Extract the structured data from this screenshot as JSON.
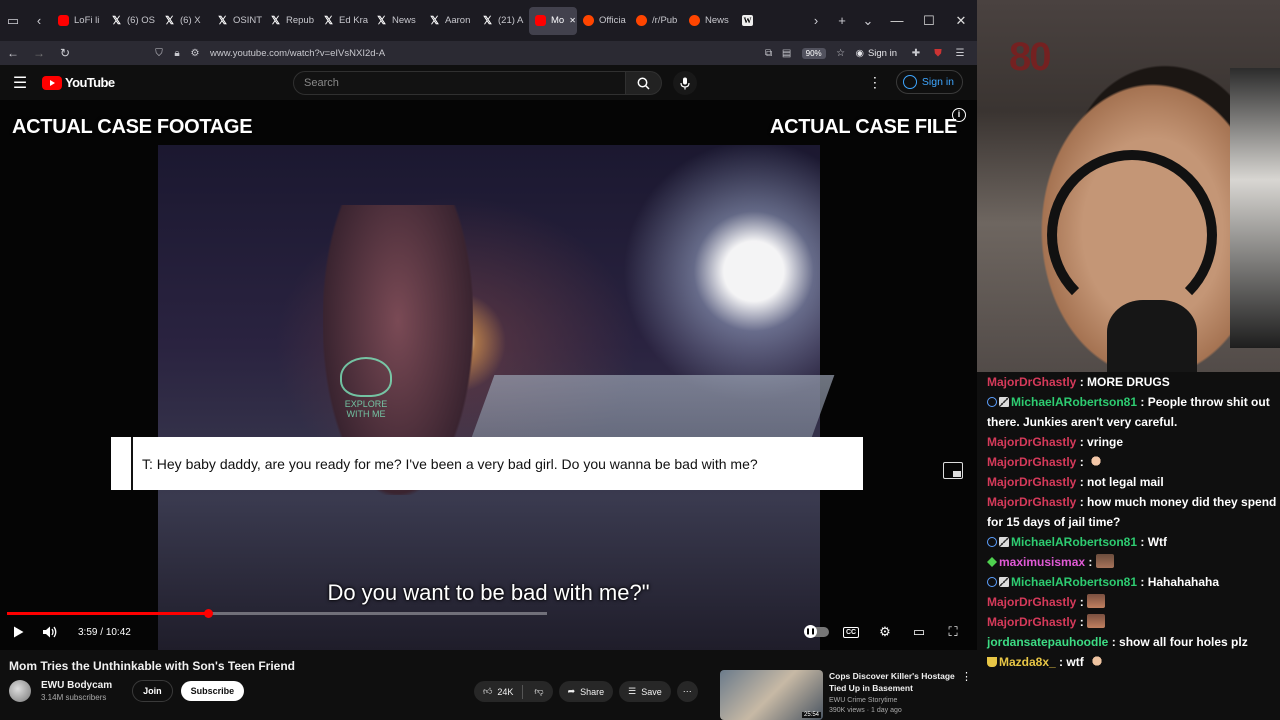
{
  "browser": {
    "tabs": [
      {
        "label": "LoFi li",
        "icon": "youtube",
        "active": false
      },
      {
        "label": "(6) OS",
        "icon": "x",
        "active": false
      },
      {
        "label": "(6) X",
        "icon": "x",
        "active": false
      },
      {
        "label": "OSINT",
        "icon": "x",
        "active": false
      },
      {
        "label": "Repub",
        "icon": "x",
        "active": false
      },
      {
        "label": "Ed Kra",
        "icon": "x",
        "active": false
      },
      {
        "label": "News",
        "icon": "x",
        "active": false
      },
      {
        "label": "Aaron",
        "icon": "x",
        "active": false
      },
      {
        "label": "(21) A",
        "icon": "x",
        "active": false
      },
      {
        "label": "Mo",
        "icon": "youtube",
        "active": true
      },
      {
        "label": "Officia",
        "icon": "reddit",
        "active": false
      },
      {
        "label": "/r/Pub",
        "icon": "reddit",
        "active": false
      },
      {
        "label": "News",
        "icon": "reddit",
        "active": false
      },
      {
        "label": "W",
        "icon": "wiki",
        "active": false
      }
    ],
    "url": "www.youtube.com/watch?v=eIVsNXI2d-A",
    "zoom": "90%",
    "sign_in": "Sign in",
    "ext_badge": "229"
  },
  "youtube": {
    "logo_text": "YouTube",
    "search_placeholder": "Search",
    "sign_in": "Sign in",
    "video": {
      "label_left": "ACTUAL CASE FOOTAGE",
      "label_right": "ACTUAL CASE FILE",
      "text_message": "T: Hey baby daddy, are you ready for me? I've been a very bad girl. Do you wanna be bad with me?",
      "subtitle": "Do you want to be bad with me?\"",
      "watermark": "EXPLORE WITH ME",
      "time_current": "3:59",
      "time_total": "10:42",
      "progress": 0.372
    },
    "title": "Mom Tries the Unthinkable with Son's Teen Friend",
    "channel": {
      "name": "EWU Bodycam",
      "subscribers": "3.14M subscribers",
      "join": "Join",
      "subscribe": "Subscribe"
    },
    "actions": {
      "likes": "24K",
      "share": "Share",
      "save": "Save"
    },
    "suggestion": {
      "title": "Cops Discover Killer's Hostage Tied Up in Basement",
      "channel": "EWU Crime Storytime",
      "meta": "390K views · 1 day ago",
      "duration": "25:54"
    }
  },
  "stream": {
    "cam_logo": "80",
    "chat": [
      {
        "user": "MajorDrGhastly",
        "color": "#d63a5a",
        "badges": [],
        "text": "MORE DRUGS",
        "emote": null
      },
      {
        "user": "MichaelARobertson81",
        "color": "#2ecc71",
        "badges": [
          "mod",
          "sub"
        ],
        "text": "People throw shit out there. Junkies aren't very careful.",
        "emote": null
      },
      {
        "user": "MajorDrGhastly",
        "color": "#d63a5a",
        "badges": [],
        "text": "vringe",
        "emote": null
      },
      {
        "user": "MajorDrGhastly",
        "color": "#d63a5a",
        "badges": [],
        "text": "",
        "emote": "hand"
      },
      {
        "user": "MajorDrGhastly",
        "color": "#d63a5a",
        "badges": [],
        "text": "not legal mail",
        "emote": null
      },
      {
        "user": "MajorDrGhastly",
        "color": "#d63a5a",
        "badges": [],
        "text": "how much money did they spend for 15 days of jail time?",
        "emote": null
      },
      {
        "user": "MichaelARobertson81",
        "color": "#2ecc71",
        "badges": [
          "mod",
          "sub"
        ],
        "text": "Wtf",
        "emote": null
      },
      {
        "user": "maximusismax",
        "color": "#e15ad6",
        "badges": [
          "gem"
        ],
        "text": "",
        "emote": "face"
      },
      {
        "user": "MichaelARobertson81",
        "color": "#2ecc71",
        "badges": [
          "mod",
          "sub"
        ],
        "text": "Hahahahaha",
        "emote": null
      },
      {
        "user": "MajorDrGhastly",
        "color": "#d63a5a",
        "badges": [],
        "text": "",
        "emote": "face2"
      },
      {
        "user": "MajorDrGhastly",
        "color": "#d63a5a",
        "badges": [],
        "text": "",
        "emote": "face2"
      },
      {
        "user": "jordansatepauhoodle",
        "color": "#3ddc84",
        "badges": [],
        "text": "show all four holes plz",
        "emote": null
      },
      {
        "user": "Mazda8x_",
        "color": "#e8c646",
        "badges": [
          "cup"
        ],
        "text": "wtf",
        "emote": "hand2"
      }
    ]
  },
  "colors": {
    "yt_red": "#ff0000",
    "link_blue": "#3ea6ff",
    "chat_red": "#d63a5a",
    "chat_green": "#2ecc71"
  }
}
